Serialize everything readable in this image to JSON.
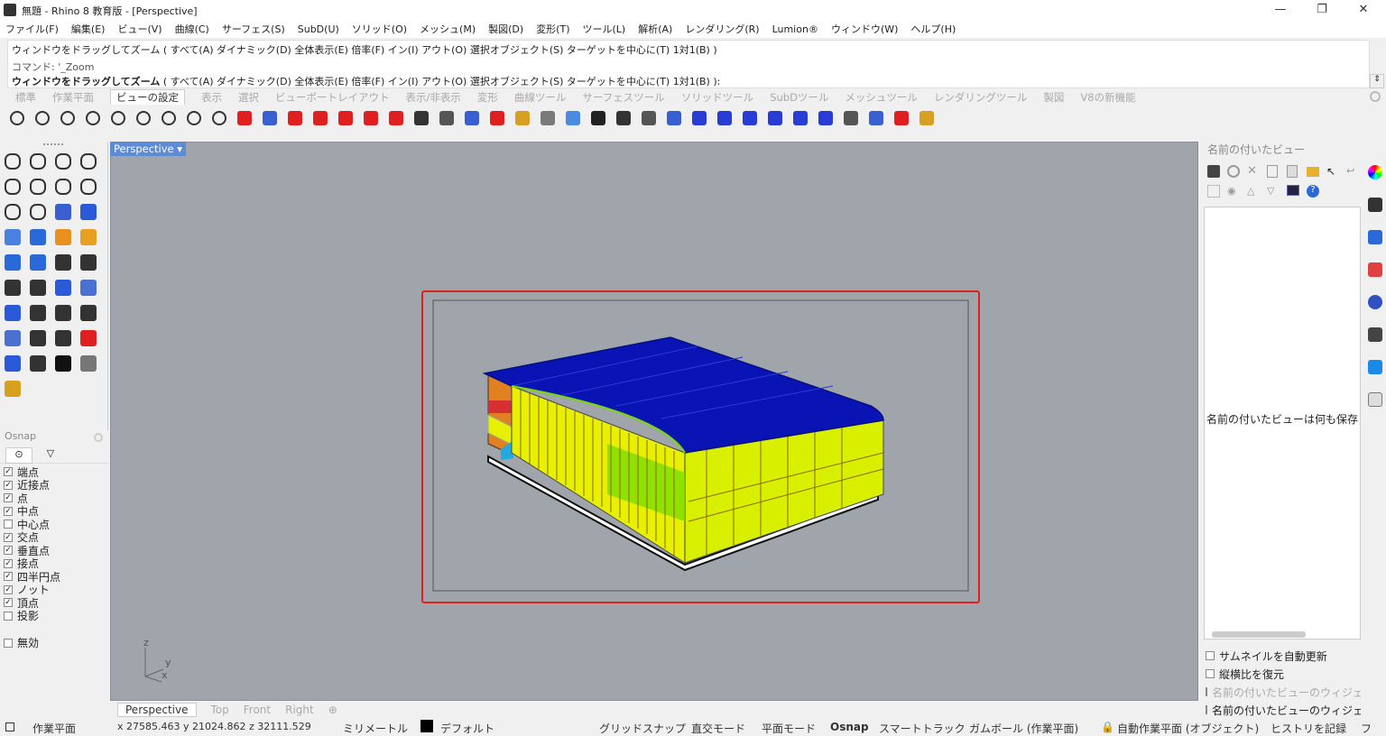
{
  "window": {
    "title": "無題 - Rhino 8 教育版 - [Perspective]",
    "minimize": "—",
    "restore": "❐",
    "close": "✕"
  },
  "menu": [
    "ファイル(F)",
    "編集(E)",
    "ビュー(V)",
    "曲線(C)",
    "サーフェス(S)",
    "SubD(U)",
    "ソリッド(O)",
    "メッシュ(M)",
    "製図(D)",
    "変形(T)",
    "ツール(L)",
    "解析(A)",
    "レンダリング(R)",
    "Lumion®",
    "ウィンドウ(W)",
    "ヘルプ(H)"
  ],
  "command": {
    "history_line": "ウィンドウをドラッグしてズーム ( すべて(A)  ダイナミック(D)  全体表示(E)  倍率(F)  イン(I)  アウト(O)  選択オブジェクト(S)  ターゲットを中心に(T)  1対1(B) )",
    "history_cmd": "コマンド: '_Zoom",
    "prompt_bold": "ウィンドウをドラッグしてズーム",
    "prompt_rest": " ( すべて(A)  ダイナミック(D)  全体表示(E)  倍率(F)  イン(I)  アウト(O)  選択オブジェクト(S)  ターゲットを中心に(T)  1対1(B) ):"
  },
  "toolbar_tabs": [
    "標準",
    "作業平面",
    "ビューの設定",
    "表示",
    "選択",
    "ビューポートレイアウト",
    "表示/非表示",
    "変形",
    "曲線ツール",
    "サーフェスツール",
    "ソリッドツール",
    "SubDツール",
    "メッシュツール",
    "レンダリングツール",
    "製図",
    "V8の新機能"
  ],
  "toolbar_active_tab": "ビューの設定",
  "toolbar_icons": [
    "pan-icon",
    "rotate-view-icon",
    "zoom-dynamic-icon",
    "zoom-extents-icon",
    "zoom-window-icon",
    "zoom-selected-icon",
    "undo-view-icon",
    "zoom-target-icon",
    "zoom-1to1-icon",
    "camera-red-icon",
    "camera-lens-icon",
    "car-front-icon",
    "car-side-icon",
    "car-wide-icon",
    "car-back-icon",
    "car-detail-icon",
    "camera-set-icon",
    "screenshot-icon",
    "camera-print-icon",
    "views-grid-icon",
    "lamp-icon",
    "spotlight-icon",
    "circle-target-icon",
    "spiral-target-icon",
    "tripod-icon",
    "cube-view-icon",
    "shield-view-icon",
    "plane-front-icon",
    "plane-top-icon",
    "plane-side-icon",
    "plane-wing-icon",
    "plane-flat-icon",
    "plane-wide-icon",
    "rotate-360-icon",
    "rotate-arrow-icon",
    "sparkle-icon",
    "gizmo-icon"
  ],
  "osnap": {
    "header": "Osnap",
    "items": [
      {
        "label": "端点",
        "checked": true
      },
      {
        "label": "近接点",
        "checked": true
      },
      {
        "label": "点",
        "checked": true
      },
      {
        "label": "中点",
        "checked": true
      },
      {
        "label": "中心点",
        "checked": false
      },
      {
        "label": "交点",
        "checked": true
      },
      {
        "label": "垂直点",
        "checked": true
      },
      {
        "label": "接点",
        "checked": true
      },
      {
        "label": "四半円点",
        "checked": true
      },
      {
        "label": "ノット",
        "checked": true
      },
      {
        "label": "頂点",
        "checked": true
      },
      {
        "label": "投影",
        "checked": false
      }
    ],
    "disable_label": "無効"
  },
  "viewport": {
    "name": "Perspective",
    "axis_z": "z",
    "axis_y": "y",
    "axis_x": "x",
    "tabs": [
      "Perspective",
      "Top",
      "Front",
      "Right"
    ],
    "add_tab": "⊕"
  },
  "named_views": {
    "header": "名前の付いたビュー",
    "empty_text": "名前の付いたビューは何も保存されていません",
    "options": [
      {
        "label": "サムネイルを自動更新",
        "enabled": true
      },
      {
        "label": "縦横比を復元",
        "enabled": true
      },
      {
        "label": "名前の付いたビューのウィジェット",
        "enabled": false
      },
      {
        "label": "名前の付いたビューのウィジェット",
        "enabled": true
      }
    ]
  },
  "statusbar": {
    "cplane": "作業平面",
    "coords": "x 27585.463  y 21024.862  z 32111.529",
    "units": "ミリメートル",
    "layer": "デフォルト",
    "grid_snap": "グリッドスナップ",
    "ortho": "直交モード",
    "planar": "平面モード",
    "osnap": "Osnap",
    "smart_track": "スマートトラック",
    "gumball": "ガムボール (作業平面)",
    "auto_cplane": "自動作業平面 (オブジェクト)",
    "history": "ヒストリを記録",
    "filter": "フ"
  },
  "colors": {
    "viewport_bg": "#a0a5ac",
    "roof_blue": "#0a14b4",
    "facade_yellow": "#e6f000",
    "facade_green": "#7adc00",
    "frame_red": "#d83030",
    "label_blue": "#5e8bd6"
  }
}
